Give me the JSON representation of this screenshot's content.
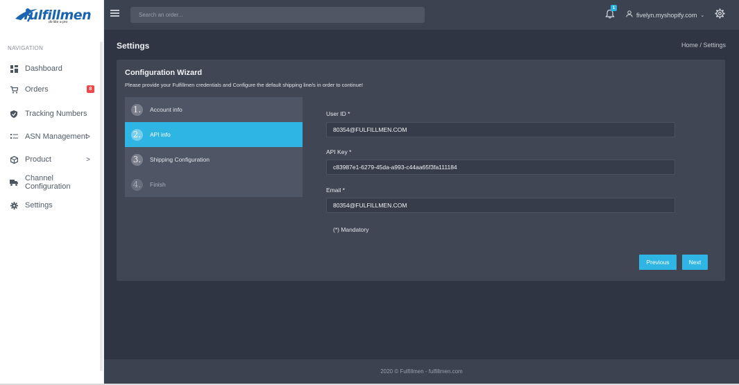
{
  "brand": {
    "logo_text": "fulfillmen",
    "tagline": "do like a pro"
  },
  "sidebar": {
    "heading": "NAVIGATION",
    "items": [
      {
        "label": "Dashboard",
        "icon": "dashboard-icon"
      },
      {
        "label": "Orders",
        "icon": "cart-icon",
        "badge": "8"
      },
      {
        "label": "Tracking Numbers",
        "icon": "shield-icon"
      },
      {
        "label": "ASN Management",
        "icon": "list-icon",
        "chevron": ">"
      },
      {
        "label": "Product",
        "icon": "box-icon",
        "chevron": ">"
      },
      {
        "label": "Channel Configuration",
        "icon": "truck-icon"
      },
      {
        "label": "Settings",
        "icon": "gear-icon"
      }
    ]
  },
  "topbar": {
    "search_placeholder": "Search an order...",
    "notification_count": "1",
    "user": "fivelyn.myshopify.com",
    "user_caret": "⌄"
  },
  "page": {
    "title": "Settings",
    "breadcrumb": "Home / Settings"
  },
  "wizard": {
    "title": "Configuration Wizard",
    "subtitle": "Please provide your Fulfillmen credentials and Configure the default shipping line/s in order to continue!",
    "steps": [
      {
        "num": "1.",
        "label": "Account info",
        "state": "done"
      },
      {
        "num": "2.",
        "label": "API info",
        "state": "active"
      },
      {
        "num": "3.",
        "label": "Shipping Configuration",
        "state": "pending"
      },
      {
        "num": "4.",
        "label": "Finish",
        "state": "muted"
      }
    ],
    "fields": {
      "user_id_label": "User ID *",
      "user_id_value": "80354@FULFILLMEN.COM",
      "api_key_label": "API Key *",
      "api_key_value": "c83987e1-6279-45da-a993-c44aa65f3fa111184",
      "email_label": "Email *",
      "email_value": "80354@FULFILLMEN.COM"
    },
    "mandatory_note": "(*) Mandatory",
    "previous_label": "Previous",
    "next_label": "Next"
  },
  "footer": {
    "text": "2020 © Fulfillmen - fulfillmen.com"
  },
  "colors": {
    "accent": "#2fb5e3",
    "topbar": "#3c4350",
    "main_bg": "#2f3542",
    "card_bg": "#404654",
    "badge_red": "#f0484a"
  }
}
